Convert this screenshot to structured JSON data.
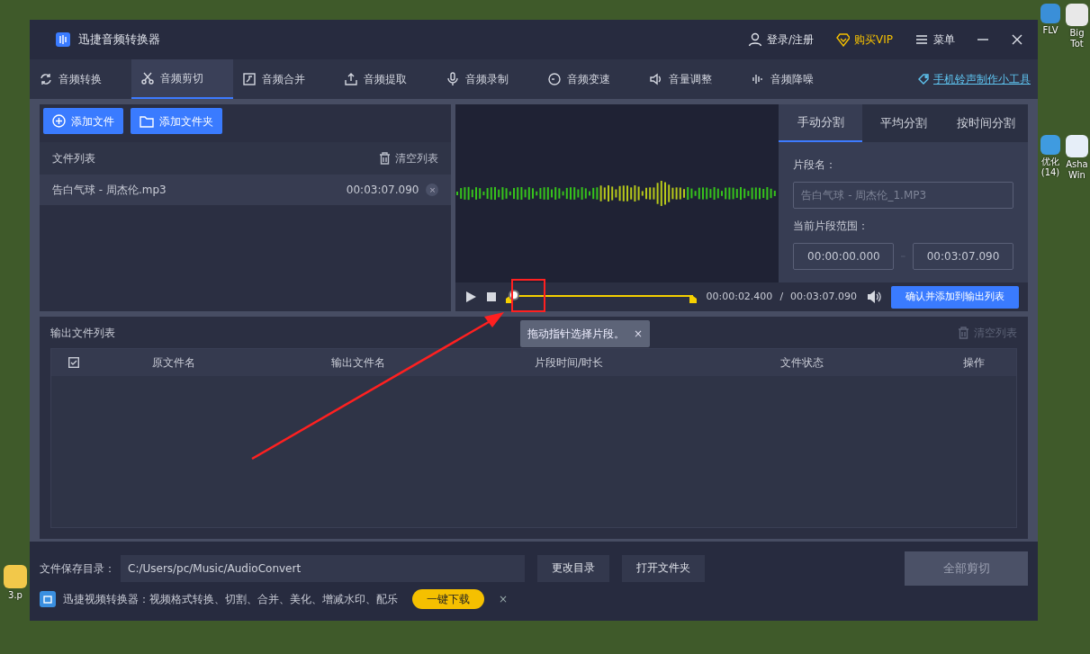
{
  "desktop": {
    "icons": [
      {
        "label": "FLV",
        "color": "#3a8fd8"
      },
      {
        "label": "Big Tot",
        "color": "#e8e8e8"
      },
      {
        "label": "优化 (14)",
        "color": "#3f9be0"
      },
      {
        "label": "Asha Win",
        "color": "#e6eef8"
      },
      {
        "label": "3.p",
        "color": "#f2c84a"
      }
    ]
  },
  "app": {
    "title": "迅捷音频转换器",
    "header_actions": [
      {
        "kind": "user",
        "label": "登录/注册"
      },
      {
        "kind": "vip",
        "label": "购买VIP"
      },
      {
        "kind": "menu",
        "label": "菜单"
      }
    ],
    "tabs": [
      {
        "label": "音频转换",
        "selected": false
      },
      {
        "label": "音频剪切",
        "selected": true
      },
      {
        "label": "音频合并",
        "selected": false
      },
      {
        "label": "音频提取",
        "selected": false
      },
      {
        "label": "音频录制",
        "selected": false
      },
      {
        "label": "音频变速",
        "selected": false
      },
      {
        "label": "音量调整",
        "selected": false
      },
      {
        "label": "音频降噪",
        "selected": false
      }
    ],
    "ringtone_link": "手机铃声制作小工具",
    "file_panel": {
      "buttons": [
        {
          "kind": "file",
          "label": "添加文件"
        },
        {
          "kind": "folder",
          "label": "添加文件夹"
        }
      ],
      "list_title": "文件列表",
      "clear_label": "清空列表",
      "files": [
        {
          "name": "告白气球 - 周杰伦.mp3",
          "duration": "00:03:07.090",
          "remove": "×",
          "selected": true
        }
      ]
    },
    "player": {
      "level": 0.013,
      "current": "00:00:02.400",
      "separator": "/",
      "total": "00:03:07.090",
      "confirm": "确认并添加到输出列表"
    },
    "split": {
      "tabs": [
        {
          "label": "手动分割",
          "selected": true
        },
        {
          "label": "平均分割",
          "selected": false
        },
        {
          "label": "按时间分割",
          "selected": false
        }
      ],
      "segment_label": "片段名：",
      "segment_placeholder": "告白气球 - 周杰伦_1.MP3",
      "range_label": "当前片段范围：",
      "start": "00:00:00.000",
      "end": "00:03:07.090"
    },
    "tooltip": {
      "text": "拖动指针选择片段。",
      "close": "×"
    },
    "output": {
      "title": "输出文件列表",
      "clear_label": "清空列表",
      "clear_disabled": true,
      "header_checked": true,
      "columns": [
        "原文件名",
        "输出文件名",
        "片段时间/时长",
        "文件状态",
        "操作"
      ]
    },
    "footer": {
      "save_label": "文件保存目录：",
      "path": "C:/Users/pc/Music/AudioConvert",
      "buttons": [
        "更改目录",
        "打开文件夹"
      ],
      "cut_all": "全部剪切",
      "cut_all_disabled": true,
      "promo_text": "迅捷视频转换器：视频格式转换、切割、合并、美化、增减水印、配乐",
      "download": "一键下载",
      "promo_close": "×"
    }
  }
}
